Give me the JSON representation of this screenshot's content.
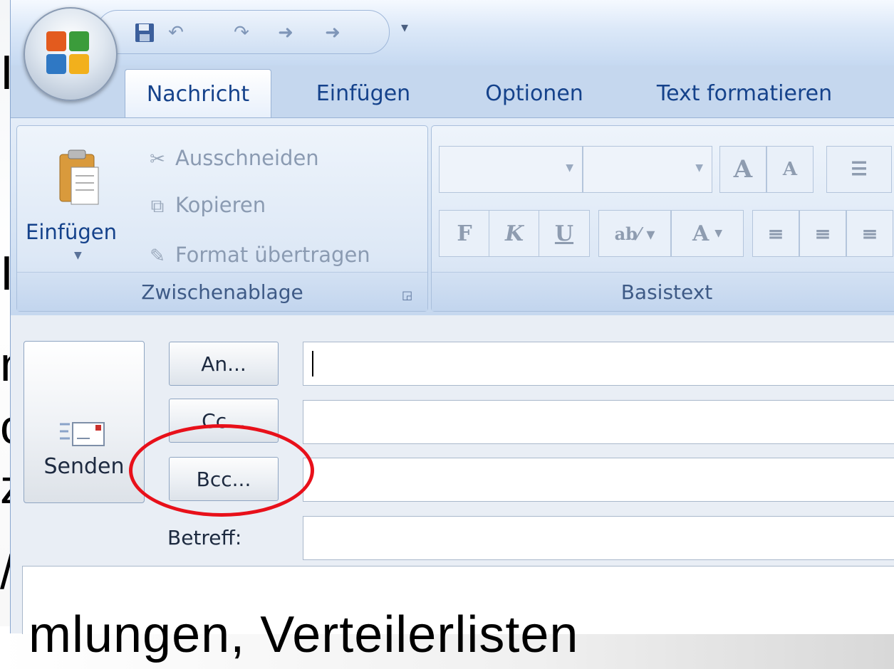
{
  "slide": {
    "bottom_text": "mlungen, Verteilerlisten",
    "fragments": [
      "I",
      "I",
      "n",
      "c",
      "z",
      "/"
    ]
  },
  "quick_access": {
    "save_icon": "save-icon",
    "undo_icon": "undo-icon",
    "redo_icon": "redo-icon"
  },
  "tabs": [
    {
      "label": "Nachricht",
      "active": true
    },
    {
      "label": "Einfügen",
      "active": false
    },
    {
      "label": "Optionen",
      "active": false
    },
    {
      "label": "Text formatieren",
      "active": false
    }
  ],
  "ribbon": {
    "clipboard": {
      "paste_label": "Einfügen",
      "cut_label": "Ausschneiden",
      "copy_label": "Kopieren",
      "format_painter_label": "Format übertragen",
      "group_label": "Zwischenablage"
    },
    "basic_text": {
      "group_label": "Basistext",
      "font_value": "",
      "size_value": "",
      "bold": "F",
      "italic": "K",
      "underline": "U",
      "grow_font": "A",
      "shrink_font": "A",
      "font_color": "A"
    }
  },
  "message": {
    "send_label": "Senden",
    "to_label": "An...",
    "cc_label": "Cc...",
    "bcc_label": "Bcc...",
    "subject_label": "Betreff:",
    "to_value": "",
    "cc_value": "",
    "bcc_value": "",
    "subject_value": ""
  },
  "colors": {
    "highlight": "#e8101a",
    "ribbon_text": "#15428b",
    "slide_accent": "#2b8fb5"
  }
}
